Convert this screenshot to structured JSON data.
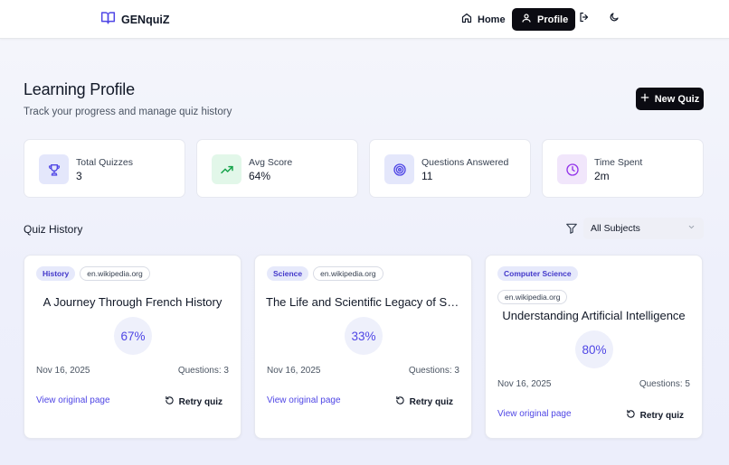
{
  "header": {
    "brand": "GENquiZ",
    "nav_home": "Home",
    "nav_profile": "Profile",
    "icons": [
      "book-icon",
      "home-icon",
      "user-icon",
      "logout-icon",
      "moon-icon"
    ]
  },
  "page": {
    "title": "Learning Profile",
    "subtitle": "Track your progress and manage quiz history",
    "new_quiz_label": "New Quiz"
  },
  "stats": [
    {
      "label": "Total Quizzes",
      "value": "3",
      "icon": "trophy-icon",
      "color": "#4f46e5"
    },
    {
      "label": "Avg Score",
      "value": "64%",
      "icon": "trending-up-icon",
      "color": "#16a34a"
    },
    {
      "label": "Questions Answered",
      "value": "11",
      "icon": "target-icon",
      "color": "#4f46e5"
    },
    {
      "label": "Time Spent",
      "value": "2m",
      "icon": "clock-icon",
      "color": "#9333ea"
    }
  ],
  "history": {
    "title": "Quiz History",
    "filter_value": "All Subjects"
  },
  "quizzes": [
    {
      "subject": "History",
      "domain": "en.wikipedia.org",
      "title": "A Journey Through French History",
      "score": "67%",
      "date": "Nov 16, 2025",
      "questions": "Questions: 3",
      "view_label": "View original page",
      "retry_label": "Retry quiz"
    },
    {
      "subject": "Science",
      "domain": "en.wikipedia.org",
      "title": "The Life and Scientific Legacy of Ste…",
      "score": "33%",
      "date": "Nov 16, 2025",
      "questions": "Questions: 3",
      "view_label": "View original page",
      "retry_label": "Retry quiz"
    },
    {
      "subject": "Computer Science",
      "domain": "en.wikipedia.org",
      "title": "Understanding Artificial Intelligence",
      "score": "80%",
      "date": "Nov 16, 2025",
      "questions": "Questions: 5",
      "view_label": "View original page",
      "retry_label": "Retry quiz"
    }
  ],
  "colors": {
    "accent": "#4f46e5",
    "dark": "#0b0b12"
  }
}
